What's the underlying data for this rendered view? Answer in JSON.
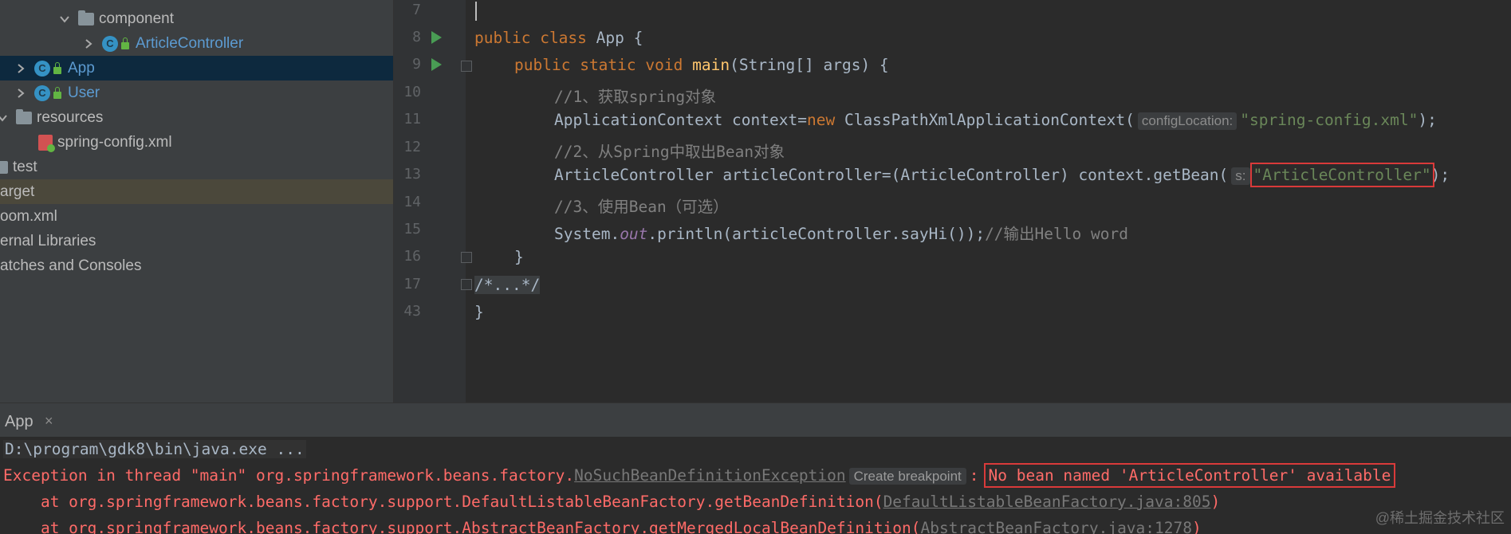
{
  "project_tree": {
    "items": [
      {
        "label": "component",
        "type": "package"
      },
      {
        "label": "ArticleController",
        "type": "class"
      },
      {
        "label": "App",
        "type": "class"
      },
      {
        "label": "User",
        "type": "class"
      },
      {
        "label": "resources",
        "type": "folder"
      },
      {
        "label": "spring-config.xml",
        "type": "xml"
      },
      {
        "label": "test",
        "type": "folder"
      },
      {
        "label": "arget",
        "type": "folder"
      },
      {
        "label": "oom.xml",
        "type": "file"
      },
      {
        "label": "ernal Libraries",
        "type": "libs"
      },
      {
        "label": "atches and Consoles",
        "type": "scratches"
      }
    ]
  },
  "editor": {
    "line_numbers": [
      "7",
      "8",
      "9",
      "10",
      "11",
      "12",
      "13",
      "14",
      "15",
      "16",
      "17",
      "43"
    ],
    "line8": {
      "kw1": "public",
      "kw2": "class",
      "rest": " App {"
    },
    "line9": {
      "kw1": "public",
      "kw2": "static",
      "kw3": "void",
      "fn": "main",
      "rest": "(String[] args) {"
    },
    "line10": "//1、获取spring对象",
    "line11": {
      "pre": "ApplicationContext context=",
      "kw": "new",
      "mid": " ClassPathXmlApplicationContext(",
      "hint": "configLocation:",
      "str": "\"spring-config.xml\"",
      "post": ");"
    },
    "line12": "//2、从Spring中取出Bean对象",
    "line13": {
      "pre": "ArticleController articleController=(ArticleController) context.getBean(",
      "hint": "s:",
      "str": "\"ArticleController\"",
      "post": ");"
    },
    "line14": "//3、使用Bean（可选）",
    "line15": {
      "pre": "System.",
      "field": "out",
      "mid": ".println(articleController.sayHi());",
      "comment": "//输出Hello word"
    },
    "line16": "}",
    "line17": "/*...*/",
    "line43": "}"
  },
  "run_panel": {
    "tab_label": "App",
    "close_glyph": "×",
    "cmd": "D:\\program\\gdk8\\bin\\java.exe ...",
    "exception_prefix": "Exception in thread \"main\" org.springframework.beans.factory.",
    "exception_class": "NoSuchBeanDefinitionException",
    "create_breakpoint": "Create breakpoint",
    "exception_sep": ":",
    "exception_message": "No bean named 'ArticleController' available",
    "trace1_pre": "    at org.springframework.beans.factory.support.DefaultListableBeanFactory.getBeanDefinition(",
    "trace1_link": "DefaultListableBeanFactory.java:805",
    "trace1_post": ")",
    "trace2_pre": "    at org.springframework.beans.factory.support.AbstractBeanFactory.getMergedLocalBeanDefinition(",
    "trace2_link": "AbstractBeanFactory.java:1278",
    "trace2_post": ")"
  },
  "watermark": "@稀土掘金技术社区",
  "colors": {
    "keyword": "#cc7832",
    "string": "#6a8759",
    "comment": "#808080",
    "method": "#ffc66d",
    "error": "#ff6b68",
    "highlight_box": "#d93a3a",
    "run_marker": "#499c54"
  }
}
